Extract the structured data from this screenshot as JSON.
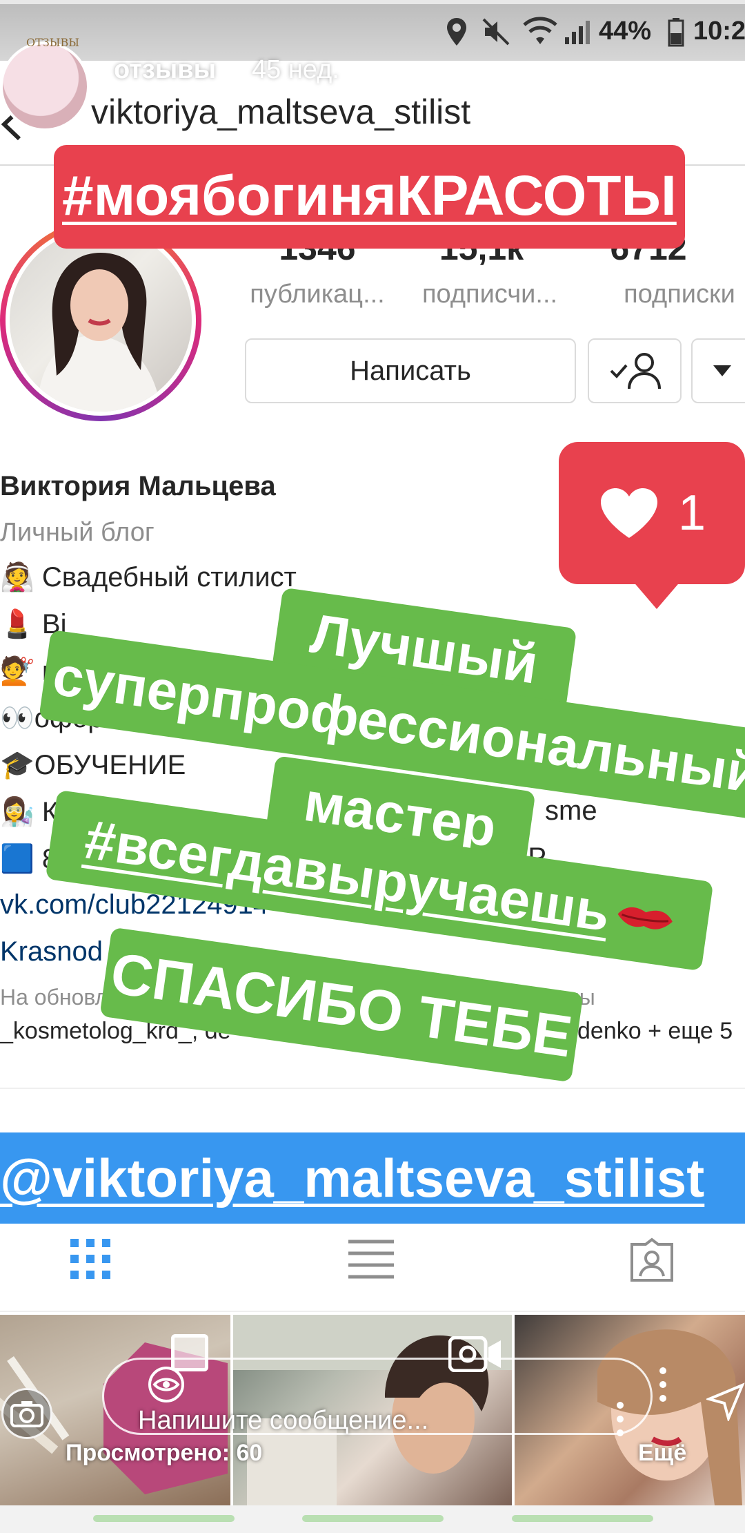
{
  "story": {
    "title": "отзывы",
    "time": "45 нед.",
    "viewed": "Просмотрено: 60",
    "more": "Ещё",
    "reply_placeholder": "Напишите сообщение...",
    "avatar_logo_text": "ОТЗЫВЫ"
  },
  "status_bar": {
    "battery": "44%",
    "time": "10:2"
  },
  "profile": {
    "username": "viktoriya_maltseva_stilist",
    "stats": [
      {
        "value": "1346",
        "label": "публикац..."
      },
      {
        "value": "15,1к",
        "label": "подписчи..."
      },
      {
        "value": "6712",
        "label": "подписки"
      }
    ],
    "message_button": "Написать",
    "name": "Виктория Мальцева",
    "category": "Личный блог",
    "bio": [
      "👰 Свадебный стилист",
      "💄 Ві",
      "💇 пр",
      "👀оформление",
      "🎓ОБУЧЕНИЕ",
      "👩‍🔬 К",
      "🟦 8-952-86",
      "vk.com/club22124914",
      "Krasnod"
    ],
    "bio_extra": [
      "sme",
      "МР"
    ],
    "followed_by": "На обновле",
    "followed_by_end": "подписаны",
    "followed_names": "_kosmetolog_krd_, de",
    "followed_names_end": "denko + еще 5"
  },
  "stickers": {
    "hashtag_beauty": "#моябогиняКРАСОТЫ",
    "like_count": "1",
    "line_1": "Лучшый",
    "line_2": "суперпрофессиональный",
    "line_3": "мастер",
    "line_4": "#всегдавыручаешь",
    "line_5": "СПАСИБО ТЕБЕ",
    "mention": "@viktoriya_maltseva_stilist"
  },
  "colors": {
    "sticker_red": "#e8414e",
    "sticker_green": "#67bb4b",
    "mention_blue": "#3897f0",
    "tab_active": "#3897f0"
  }
}
